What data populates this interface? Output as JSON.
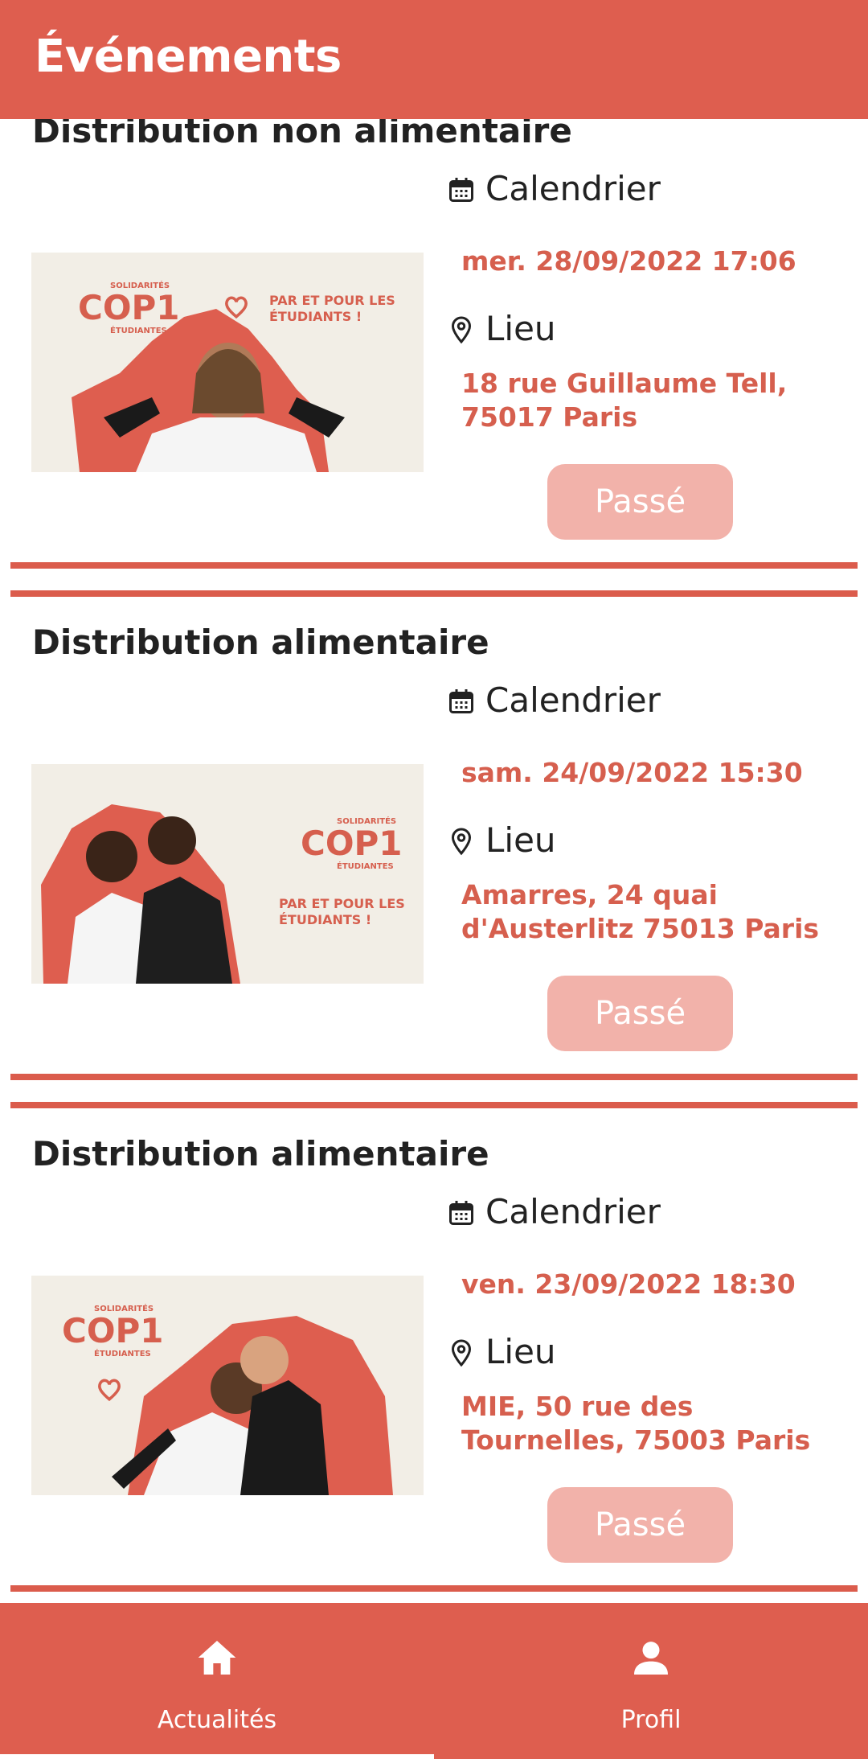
{
  "appbar": {
    "title": "Événements"
  },
  "events": [
    {
      "title": "Distribution non alimentaire",
      "calendar_label": "Calendrier",
      "date": "mer. 28/09/2022 17:06",
      "location_label": "Lieu",
      "address": "18 rue Guillaume Tell, 75017 Paris",
      "status": "Passé"
    },
    {
      "title": "Distribution alimentaire",
      "calendar_label": "Calendrier",
      "date": "sam. 24/09/2022 15:30",
      "location_label": "Lieu",
      "address": "Amarres, 24 quai d'Austerlitz 75013 Paris",
      "status": "Passé"
    },
    {
      "title": "Distribution alimentaire",
      "calendar_label": "Calendrier",
      "date": "ven. 23/09/2022 18:30",
      "location_label": "Lieu",
      "address": "MIE, 50 rue des Tournelles, 75003 Paris",
      "status": "Passé"
    }
  ],
  "poster": {
    "brand_top": "SOLIDARITÉS",
    "brand_main": "COP1",
    "brand_bottom": "ÉTUDIANTES",
    "slogan": "PAR ET POUR LES ÉTUDIANTS !"
  },
  "bottom_nav": {
    "items": [
      {
        "label": "Actualités",
        "icon": "home-icon",
        "active": true
      },
      {
        "label": "Profil",
        "icon": "person-icon",
        "active": false
      }
    ]
  },
  "colors": {
    "primary": "#DE5E4F",
    "accent_text": "#D65F4E",
    "button_disabled": "#F2B2AA",
    "poster_bg": "#F2EEE6"
  }
}
